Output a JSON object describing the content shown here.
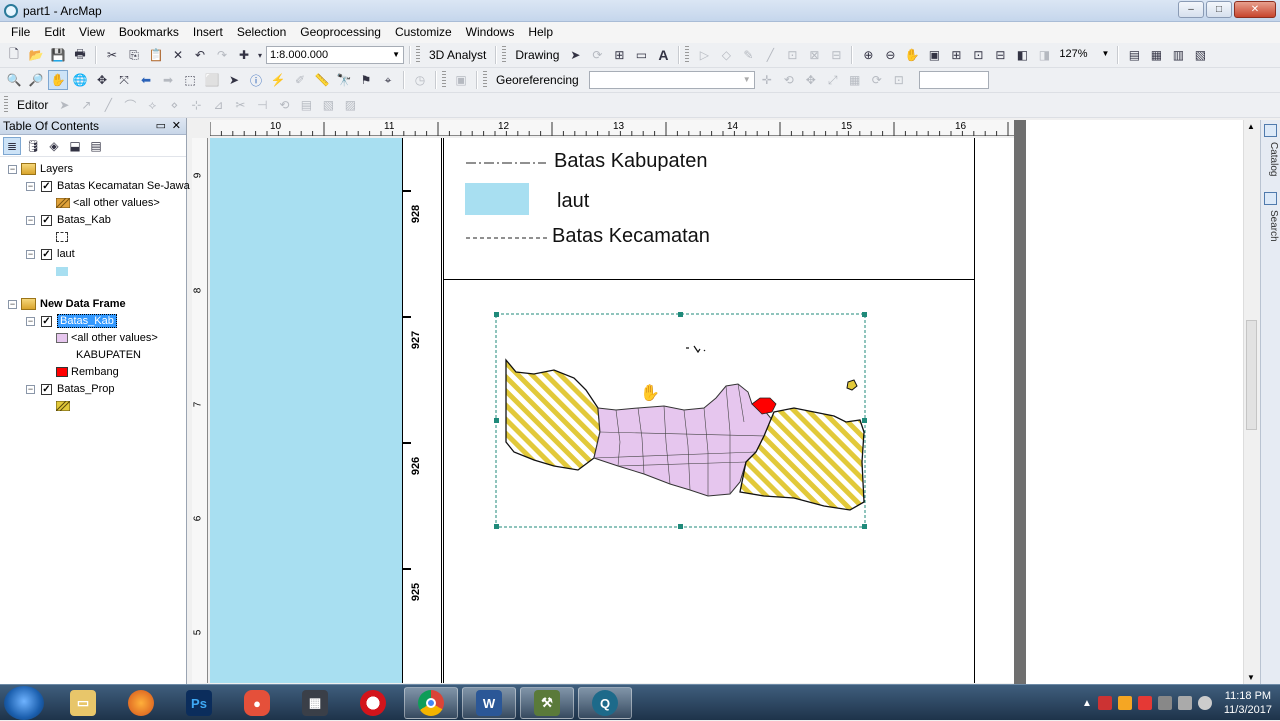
{
  "window": {
    "title": "part1 - ArcMap",
    "buttons": [
      "–",
      "□",
      "✕"
    ]
  },
  "menubar": [
    "File",
    "Edit",
    "View",
    "Bookmarks",
    "Insert",
    "Selection",
    "Geoprocessing",
    "Customize",
    "Windows",
    "Help"
  ],
  "toolbar1": {
    "scale": "1:8.000.000",
    "analyst": "3D Analyst",
    "drawing": "Drawing",
    "font_icon": "A",
    "zoom_pct": "127%"
  },
  "toolbar2": {
    "georef": "Georeferencing"
  },
  "toolbar3": {
    "editor": "Editor"
  },
  "toc": {
    "title": "Table Of Contents",
    "pin": "📌",
    "close": "✕",
    "items": [
      {
        "label": "Layers",
        "kind": "group"
      },
      {
        "label": "Batas Kecamatan Se-Jawa",
        "kind": "layer"
      },
      {
        "label": "<all other values>",
        "kind": "symbol"
      },
      {
        "label": "Batas_Kab",
        "kind": "layer"
      },
      {
        "label": "laut",
        "kind": "layer"
      },
      {
        "label": "New Data Frame",
        "kind": "group"
      },
      {
        "label": "Batas_Kab",
        "kind": "layer"
      },
      {
        "label": "<all other values>",
        "kind": "symbol"
      },
      {
        "label": "KABUPATEN",
        "kind": "heading"
      },
      {
        "label": "Rembang",
        "kind": "symbol"
      },
      {
        "label": "Batas_Prop",
        "kind": "layer"
      }
    ]
  },
  "ruler_top": [
    "10",
    "11",
    "12",
    "13",
    "14",
    "15",
    "16"
  ],
  "ruler_left": [
    "9",
    "8",
    "7",
    "6",
    "5"
  ],
  "grid_labels": [
    "928",
    "927",
    "926",
    "925"
  ],
  "legend": {
    "line1": "Batas Kabupaten",
    "fill": "laut",
    "line2": "Batas Kecamatan"
  },
  "colors": {
    "sea": "#a8dff1",
    "kabupaten": "#e6c6ee",
    "rembang": "#ff0000",
    "province_hatch": "#e2c93a"
  },
  "side_tabs": [
    "Catalog",
    "Search"
  ],
  "taskbar": {
    "apps": [
      "explorer",
      "firefox",
      "photoshop",
      "ps-app",
      "media",
      "opera",
      "chrome",
      "word",
      "arcmap-tool",
      "arcmap"
    ],
    "time": "11:18 PM",
    "date": "11/3/2017"
  }
}
